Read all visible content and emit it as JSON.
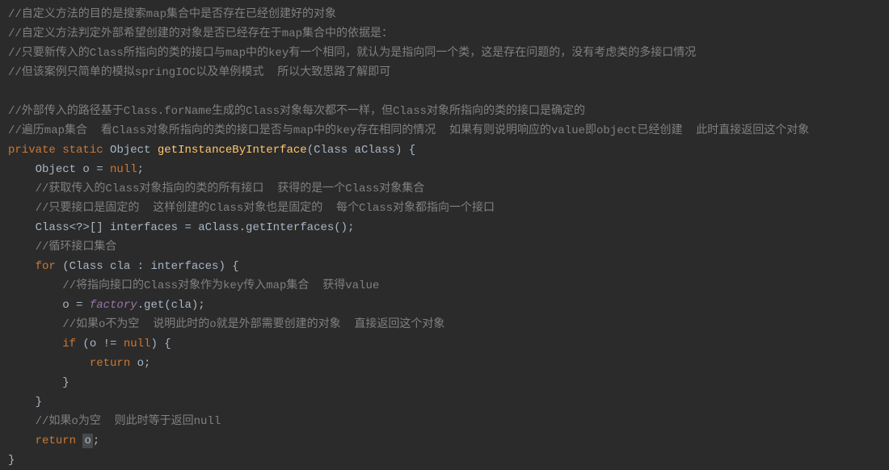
{
  "lines": {
    "c1": "//自定义方法的目的是搜索map集合中是否存在已经创建好的对象",
    "c2": "//自定义方法判定外部希望创建的对象是否已经存在于map集合中的依据是：",
    "c3": "//只要新传入的Class所指向的类的接口与map中的key有一个相同，就认为是指向同一个类，这是存在问题的，没有考虑类的多接口情况",
    "c4": "//但该案例只简单的模拟springIOC以及单例模式  所以大致思路了解即可",
    "c5": "//外部传入的路径基于Class.forName生成的Class对象每次都不一样，但Class对象所指向的类的接口是确定的",
    "c6": "//遍历map集合  看Class对象所指向的类的接口是否与map中的key存在相同的情况  如果有则说明响应的value即object已经创建  此时直接返回这个对象",
    "kw_private": "private",
    "kw_static": "static",
    "type_object": "Object",
    "method": "getInstanceByInterface",
    "type_class": "Class",
    "param": "aClass",
    "var_o": "Object o = ",
    "null_text": "null",
    "semi": ";",
    "c7": "//获取传入的Class对象指向的类的所有接口  获得的是一个Class对象集合",
    "c8": "//只要接口是固定的  这样创建的Class对象也是固定的  每个Class对象都指向一个接口",
    "interfaces_decl": "Class<?>[] interfaces = aClass.getInterfaces();",
    "c9": "//循环接口集合",
    "kw_for": "for",
    "for_cond": " (Class cla : interfaces) {",
    "c10": "//将指向接口的Class对象作为key传入map集合  获得value",
    "o_assign_pre": "o = ",
    "factory": "factory",
    "get_call": ".get(cla);",
    "c11": "//如果o不为空  说明此时的o就是外部需要创建的对象  直接返回这个对象",
    "kw_if": "if",
    "if_cond": " (o != ",
    "if_end": ") {",
    "kw_return": "return",
    "ret_o": " o;",
    "brace_close": "}",
    "c12": "//如果o为空  则此时等于返回null",
    "ret_highlight": "o"
  }
}
